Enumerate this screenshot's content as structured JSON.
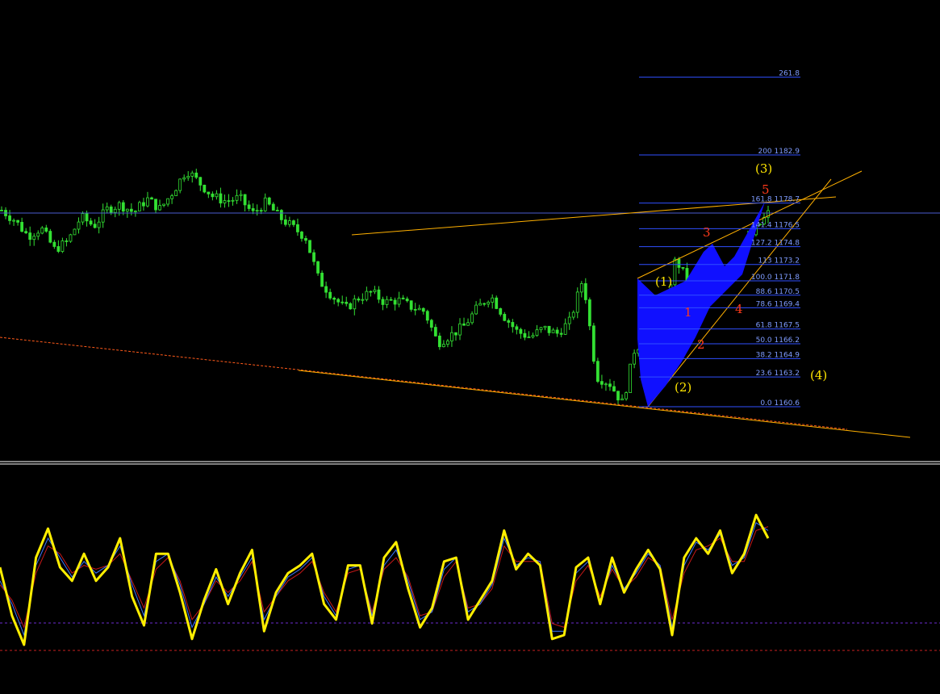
{
  "chart_data": [
    {
      "type": "line",
      "panel": "price",
      "instrument_style": "green candlesticks on black",
      "colors": {
        "background": "#000000",
        "candles": "#33e033",
        "fib_lines": "#2f4fff",
        "fib_text": "#7f9cff",
        "trendline": "#ffb000",
        "channel_fill": "#1010ff",
        "wave_primary": "#ffe600",
        "wave_minor": "#ff3a1a"
      },
      "fibonacci_levels": [
        {
          "label": "261.8",
          "ratio": 261.8,
          "price": null
        },
        {
          "label": "200 1182.9",
          "ratio": 200.0,
          "price": 1182.9
        },
        {
          "label": "161.8 1178.7",
          "ratio": 161.8,
          "price": 1178.7
        },
        {
          "label": "141.4 1176.5",
          "ratio": 141.4,
          "price": 1176.5
        },
        {
          "label": "127.2 1174.8",
          "ratio": 127.2,
          "price": 1174.8
        },
        {
          "label": "113 1173.2",
          "ratio": 113.0,
          "price": 1173.2
        },
        {
          "label": "100.0 1171.8",
          "ratio": 100.0,
          "price": 1171.8
        },
        {
          "label": "88.6 1170.5",
          "ratio": 88.6,
          "price": 1170.5
        },
        {
          "label": "78.6 1169.4",
          "ratio": 78.6,
          "price": 1169.4
        },
        {
          "label": "61.8 1167.5",
          "ratio": 61.8,
          "price": 1167.5
        },
        {
          "label": "50.0 1166.2",
          "ratio": 50.0,
          "price": 1166.2
        },
        {
          "label": "38.2 1164.9",
          "ratio": 38.2,
          "price": 1164.9
        },
        {
          "label": "23.6 1163.2",
          "ratio": 23.6,
          "price": 1163.2
        },
        {
          "label": "0.0 1160.6",
          "ratio": 0.0,
          "price": 1160.6
        }
      ],
      "price_series_approx": [
        1177.8,
        1176.9,
        1175.5,
        1176.2,
        1174.3,
        1175.0,
        1177.2,
        1176.4,
        1177.9,
        1178.3,
        1177.6,
        1178.8,
        1177.9,
        1179.5,
        1181.4,
        1180.2,
        1179.0,
        1178.6,
        1178.9,
        1177.5,
        1178.5,
        1177.2,
        1176.3,
        1175.4,
        1171.6,
        1170.2,
        1169.0,
        1170.0,
        1170.5,
        1169.6,
        1169.8,
        1169.2,
        1168.8,
        1166.0,
        1166.7,
        1167.5,
        1169.1,
        1170.2,
        1168.4,
        1167.0,
        1166.5,
        1167.3,
        1166.8,
        1167.9,
        1171.8,
        1163.0,
        1162.4,
        1160.6,
        1166.0,
        1164.5,
        1167.9,
        1173.5,
        1171.2,
        1172.0,
        1171.5,
        1172.8,
        1174.3,
        1176.0,
        1177.5
      ]
    },
    {
      "type": "line",
      "panel": "oscillator",
      "colors": {
        "main": "#ffee00",
        "signal_blue": "#3a78ff",
        "signal_red": "#c81818",
        "levels": "#6b2bd1",
        "levels_lower": "#c82020"
      },
      "series": [
        {
          "values": [
            55,
            30,
            15,
            60,
            75,
            55,
            48,
            62,
            48,
            55,
            70,
            40,
            25,
            62,
            62,
            42,
            18,
            38,
            54,
            36,
            52,
            64,
            22,
            42,
            52,
            56,
            62,
            36,
            28,
            56,
            56,
            26,
            60,
            68,
            44,
            24,
            34,
            58,
            60,
            28,
            38,
            48,
            74,
            54,
            62,
            56,
            18,
            20,
            55,
            60,
            36,
            60,
            42,
            54,
            64,
            54,
            20,
            60,
            70,
            62,
            74,
            52,
            62,
            82,
            70
          ]
        },
        {
          "values": [
            48,
            36,
            20,
            56,
            70,
            60,
            50,
            58,
            52,
            56,
            66,
            46,
            30,
            58,
            62,
            46,
            24,
            36,
            50,
            40,
            50,
            60,
            28,
            40,
            50,
            54,
            60,
            40,
            30,
            54,
            56,
            30,
            56,
            64,
            48,
            28,
            32,
            54,
            60,
            32,
            36,
            46,
            70,
            56,
            60,
            58,
            22,
            22,
            52,
            58,
            38,
            56,
            44,
            52,
            62,
            56,
            24,
            56,
            68,
            64,
            72,
            56,
            60,
            78,
            74
          ]
        },
        {
          "values": [
            46,
            38,
            24,
            52,
            66,
            62,
            52,
            56,
            54,
            56,
            62,
            48,
            34,
            54,
            60,
            48,
            28,
            36,
            48,
            42,
            48,
            58,
            32,
            40,
            48,
            52,
            58,
            42,
            32,
            52,
            54,
            32,
            54,
            60,
            50,
            30,
            32,
            50,
            58,
            34,
            36,
            44,
            66,
            58,
            58,
            58,
            26,
            24,
            48,
            56,
            40,
            54,
            44,
            50,
            60,
            56,
            28,
            52,
            64,
            66,
            70,
            58,
            58,
            74,
            76
          ]
        }
      ]
    }
  ],
  "wave_labels": {
    "primary": [
      "(1)",
      "(2)",
      "(3)",
      "(4)"
    ],
    "minor": [
      "1",
      "2",
      "3",
      "4",
      "5"
    ]
  }
}
